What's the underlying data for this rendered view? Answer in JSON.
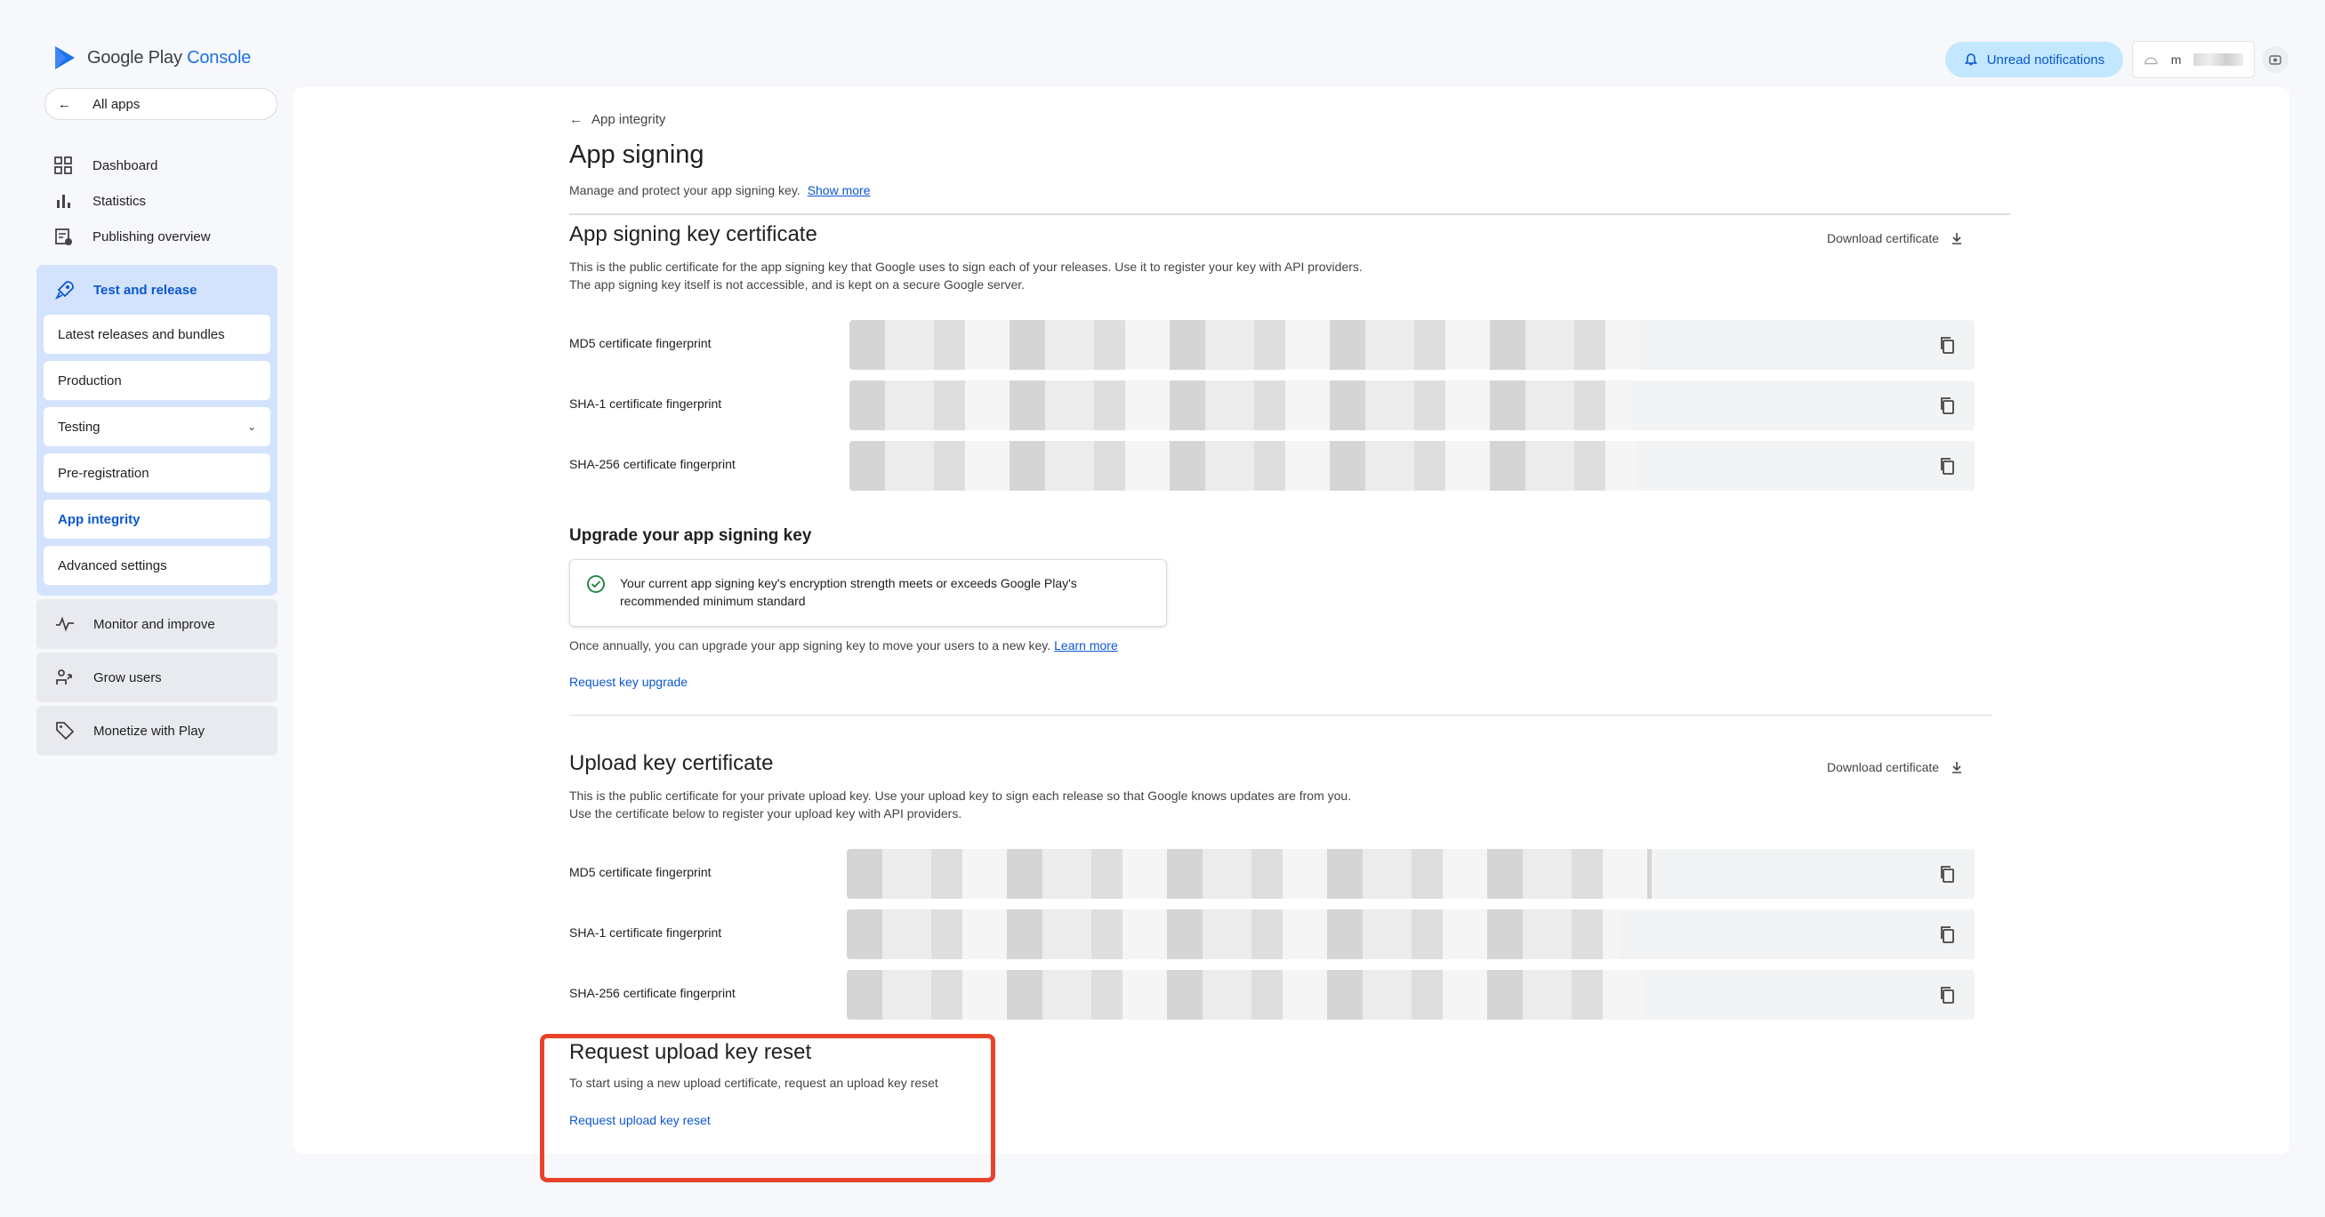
{
  "brand": {
    "name": "Google Play",
    "product": "Console"
  },
  "header": {
    "notifications_label": "Unread notifications",
    "account_initial": "m"
  },
  "sidebar": {
    "all_apps": "All apps",
    "top_items": [
      "Dashboard",
      "Statistics",
      "Publishing overview"
    ],
    "test_release": {
      "label": "Test and release",
      "items": [
        "Latest releases and bundles",
        "Production",
        "Testing",
        "Pre-registration",
        "App integrity",
        "Advanced settings"
      ]
    },
    "groups": [
      "Monitor and improve",
      "Grow users",
      "Monetize with Play"
    ]
  },
  "page": {
    "back_label": "App integrity",
    "title": "App signing",
    "description": "Manage and protect your app signing key.",
    "show_more": "Show more"
  },
  "app_signing": {
    "title": "App signing key certificate",
    "download": "Download certificate",
    "description": "This is the public certificate for the app signing key that Google uses to sign each of your releases. Use it to register your key with API providers. The app signing key itself is not accessible, and is kept on a secure Google server.",
    "fingerprints": [
      "MD5 certificate fingerprint",
      "SHA-1 certificate fingerprint",
      "SHA-256 certificate fingerprint"
    ]
  },
  "upgrade": {
    "title": "Upgrade your app signing key",
    "info": "Your current app signing key's encryption strength meets or exceeds Google Play's recommended minimum standard",
    "note": "Once annually, you can upgrade your app signing key to move your users to a new key.",
    "learn_more": "Learn more",
    "action": "Request key upgrade"
  },
  "upload_key": {
    "title": "Upload key certificate",
    "download": "Download certificate",
    "description": "This is the public certificate for your private upload key. Use your upload key to sign each release so that Google knows updates are from you. Use the certificate below to register your upload key with API providers.",
    "fingerprints": [
      "MD5 certificate fingerprint",
      "SHA-1 certificate fingerprint",
      "SHA-256 certificate fingerprint"
    ]
  },
  "reset": {
    "title": "Request upload key reset",
    "description": "To start using a new upload certificate, request an upload key reset",
    "action": "Request upload key reset"
  }
}
